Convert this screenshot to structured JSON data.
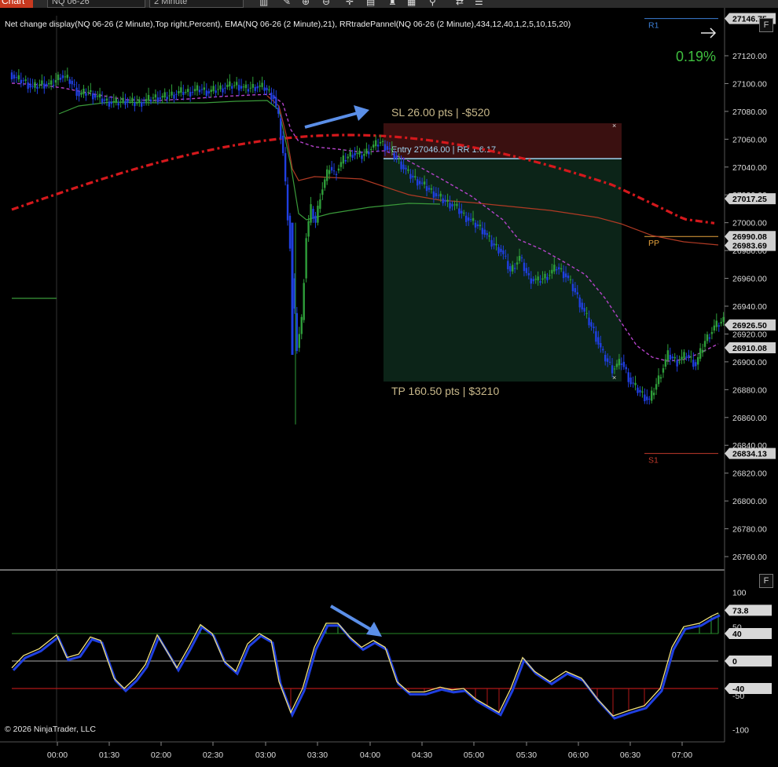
{
  "toolbar": {
    "chart_tab": "Chart",
    "instrument": "NQ 06-26",
    "interval": "2 Minute",
    "icons": [
      "bar-style-icon",
      "pencil-icon",
      "zoom-in-icon",
      "zoom-out-icon",
      "crosshair-icon",
      "data-box-icon",
      "strategies-icon",
      "properties-icon",
      "indicators-icon",
      "sync-icon",
      "menu-icon"
    ]
  },
  "indicator_label": "Net change display(NQ 06-26 (2 Minute),Top right,Percent), EMA(NQ 06-26 (2 Minute),21), RRtradePannel(NQ 06-26 (2 Minute),434,12,40,1,2,5,10,15,20)",
  "net_change": "0.19%",
  "copyright": "© 2026 NinjaTrader, LLC",
  "f_button": "F",
  "chart_data": [
    {
      "type": "candlestick",
      "instrument": "NQ 06-26",
      "interval": "2 Minute",
      "ylim": [
        26745,
        27145
      ],
      "x_ticks": [
        "00:00",
        "01:30",
        "02:00",
        "02:30",
        "03:00",
        "03:30",
        "04:00",
        "04:30",
        "05:00",
        "05:30",
        "06:00",
        "06:30",
        "07:00"
      ],
      "y_ticks": [
        26760,
        26780,
        26800,
        26820,
        26840,
        26860,
        26880,
        26900,
        26920,
        26940,
        26960,
        26980,
        27000,
        27020,
        27040,
        27060,
        27080,
        27100,
        27120
      ],
      "price_markers": [
        {
          "label": "27146.75",
          "value": 27146.75,
          "color": "#cfcfcf"
        },
        {
          "label": "27017.25",
          "value": 27017.25,
          "color": "#cfcfcf"
        },
        {
          "label": "26990.08",
          "value": 26990.08,
          "color": "#cfcfcf"
        },
        {
          "label": "26983.69",
          "value": 26983.69,
          "color": "#cfcfcf"
        },
        {
          "label": "26926.50",
          "value": 26926.5,
          "color": "#cfcfcf"
        },
        {
          "label": "26910.08",
          "value": 26910.08,
          "color": "#cfcfcf"
        },
        {
          "label": "26834.13",
          "value": 26834.13,
          "color": "#cfcfcf"
        }
      ],
      "pivots": [
        {
          "label": "R1",
          "value": 27146.75,
          "color": "#3d7fd6"
        },
        {
          "label": "PP",
          "value": 26990.08,
          "color": "#e6a23c"
        },
        {
          "label": "S1",
          "value": 26834.13,
          "color": "#c0392b"
        }
      ],
      "trade_box": {
        "sl_label": "SL 26.00 pts | -$520",
        "entry_label": "Entry 27046.00 | RR 1:6.17",
        "tp_label": "TP 160.50 pts | $3210",
        "entry": 27046.0,
        "stop": 27072.0,
        "target": 26885.5
      },
      "price_series": [
        [
          0,
          27108
        ],
        [
          3,
          27103
        ],
        [
          6,
          27102
        ],
        [
          10,
          27097
        ],
        [
          14,
          27100
        ],
        [
          18,
          27099
        ],
        [
          22,
          27106
        ],
        [
          26,
          27102
        ],
        [
          30,
          27092
        ],
        [
          34,
          27094
        ],
        [
          38,
          27090
        ],
        [
          42,
          27087
        ],
        [
          46,
          27086
        ],
        [
          50,
          27088
        ],
        [
          54,
          27086
        ],
        [
          58,
          27087
        ],
        [
          62,
          27090
        ],
        [
          66,
          27090
        ],
        [
          70,
          27092
        ],
        [
          74,
          27094
        ],
        [
          78,
          27094
        ],
        [
          82,
          27096
        ],
        [
          86,
          27094
        ],
        [
          90,
          27096
        ],
        [
          94,
          27098
        ],
        [
          98,
          27099
        ],
        [
          102,
          27096
        ],
        [
          106,
          27098
        ],
        [
          110,
          27097
        ],
        [
          114,
          27090
        ],
        [
          116,
          27075
        ],
        [
          118,
          27050
        ],
        [
          120,
          27005
        ],
        [
          122,
          26960
        ],
        [
          124,
          26910
        ],
        [
          126,
          26930
        ],
        [
          128,
          26990
        ],
        [
          130,
          27010
        ],
        [
          132,
          27000
        ],
        [
          134,
          27020
        ],
        [
          136,
          27030
        ],
        [
          138,
          27040
        ],
        [
          140,
          27035
        ],
        [
          144,
          27045
        ],
        [
          148,
          27050
        ],
        [
          152,
          27048
        ],
        [
          156,
          27054
        ],
        [
          160,
          27058
        ],
        [
          164,
          27052
        ],
        [
          168,
          27044
        ],
        [
          172,
          27035
        ],
        [
          176,
          27030
        ],
        [
          180,
          27025
        ],
        [
          184,
          27020
        ],
        [
          188,
          27015
        ],
        [
          192,
          27012
        ],
        [
          196,
          27005
        ],
        [
          200,
          27000
        ],
        [
          204,
          26995
        ],
        [
          208,
          26985
        ],
        [
          212,
          26980
        ],
        [
          216,
          26965
        ],
        [
          220,
          26975
        ],
        [
          224,
          26960
        ],
        [
          228,
          26958
        ],
        [
          232,
          26962
        ],
        [
          236,
          26968
        ],
        [
          240,
          26962
        ],
        [
          244,
          26950
        ],
        [
          248,
          26935
        ],
        [
          252,
          26922
        ],
        [
          256,
          26905
        ],
        [
          260,
          26895
        ],
        [
          264,
          26900
        ],
        [
          268,
          26885
        ],
        [
          272,
          26878
        ],
        [
          276,
          26872
        ],
        [
          280,
          26888
        ],
        [
          284,
          26905
        ],
        [
          288,
          26900
        ],
        [
          292,
          26905
        ],
        [
          296,
          26898
        ],
        [
          300,
          26915
        ],
        [
          304,
          26925
        ],
        [
          308,
          26930
        ]
      ]
    },
    {
      "type": "line",
      "name": "oscillator",
      "ylim": [
        -110,
        110
      ],
      "y_ticks": [
        100,
        50,
        0,
        -50,
        -100
      ],
      "markers": [
        {
          "label": "73.8",
          "value": 73.8
        },
        {
          "label": "40",
          "value": 40
        },
        {
          "label": "0",
          "value": 0
        },
        {
          "label": "-40",
          "value": -40
        }
      ],
      "levels": [
        40,
        0,
        -40
      ]
    }
  ]
}
